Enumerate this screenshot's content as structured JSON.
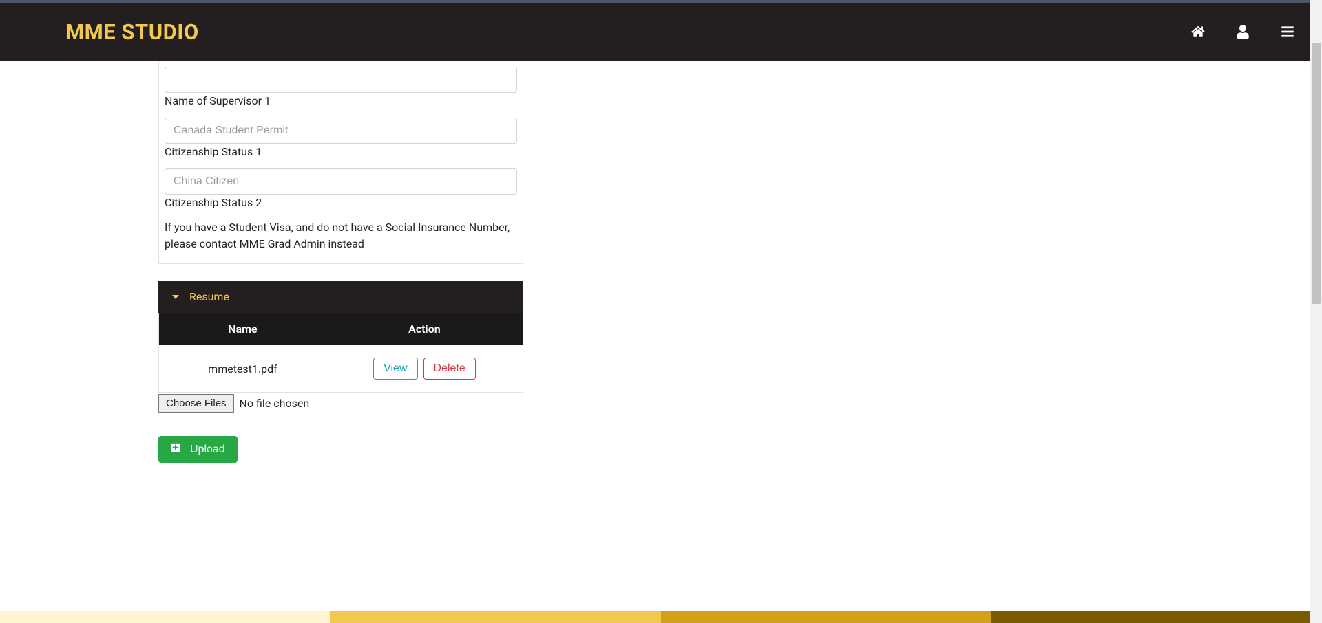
{
  "header": {
    "brand": "MME STUDIO"
  },
  "form": {
    "supervisor1": {
      "value": "",
      "label": "Name of Supervisor 1"
    },
    "citizenship1": {
      "value": "Canada Student Permit",
      "label": "Citizenship Status 1"
    },
    "citizenship2": {
      "value": "China Citizen",
      "label": "Citizenship Status 2"
    },
    "info_text": "If you have a Student Visa, and do not have a Social Insurance Number, please contact MME Grad Admin instead"
  },
  "resume": {
    "title": "Resume",
    "columns": {
      "name": "Name",
      "action": "Action"
    },
    "rows": [
      {
        "name": "mmetest1.pdf"
      }
    ],
    "view_label": "View",
    "delete_label": "Delete"
  },
  "file_chooser": {
    "button": "Choose Files",
    "status": "No file chosen"
  },
  "upload": {
    "label": "Upload"
  }
}
